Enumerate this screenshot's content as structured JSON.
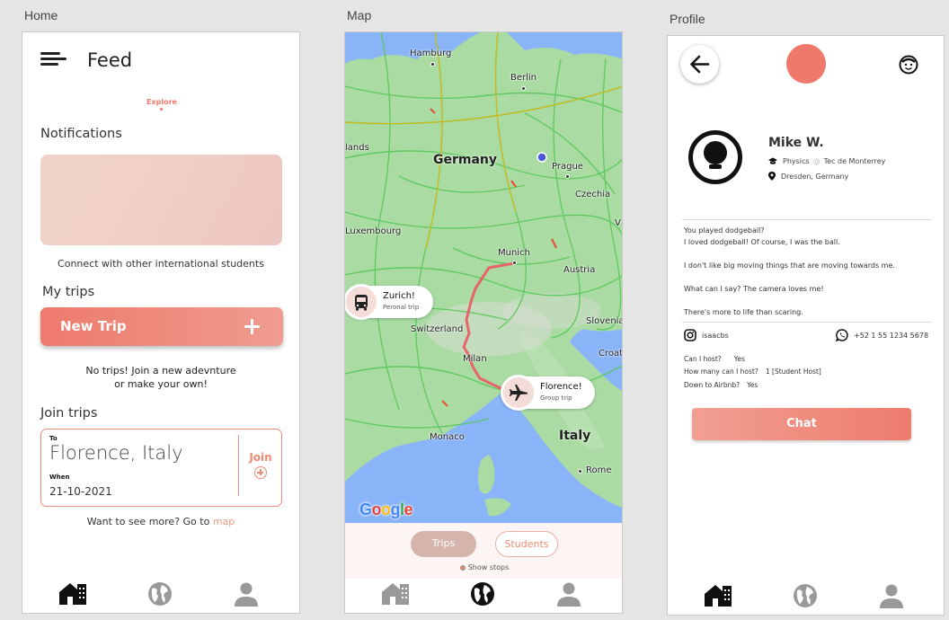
{
  "artboards": {
    "home": "Home",
    "map": "Map",
    "profile": "Profile"
  },
  "home": {
    "title": "Feed",
    "explore_label": "Explore",
    "notifications_heading": "Notifications",
    "notifications_caption": "Connect with other international students",
    "my_trips_heading": "My trips",
    "new_trip_label": "New Trip",
    "no_trips_line1": "No trips! Join a new adevnture",
    "no_trips_line2": "or make your own!",
    "join_trips_heading": "Join trips",
    "join_card": {
      "to_label": "To",
      "destination": "Florence, Italy",
      "when_label": "When",
      "date": "21-10-2021",
      "join_label": "Join"
    },
    "see_more_text": "Want to see more? Go to ",
    "see_more_link": "map"
  },
  "map": {
    "labels": {
      "germany": "Germany",
      "italy": "Italy",
      "hamburg": "Hamburg",
      "berlin": "Berlin",
      "lands": "lands",
      "prague": "Prague",
      "czechia": "Czechia",
      "luxembourg": "Luxembourg",
      "munich": "Munich",
      "austria": "Austria",
      "switzerland": "Switzerland",
      "slovenia": "Slovenia",
      "croat": "Croat",
      "milan": "Milan",
      "monaco": "Monaco",
      "rome": "Rome",
      "v_edge": "V"
    },
    "stops": [
      {
        "title": "Zurich!",
        "subtitle": "Peronal trip",
        "icon": "bus-icon"
      },
      {
        "title": "Florence!",
        "subtitle": "Group trip",
        "icon": "airplane-icon"
      }
    ],
    "google_letters": [
      {
        "ch": "G",
        "color": "#4285F4"
      },
      {
        "ch": "o",
        "color": "#EA4335"
      },
      {
        "ch": "o",
        "color": "#FBBC05"
      },
      {
        "ch": "g",
        "color": "#4285F4"
      },
      {
        "ch": "l",
        "color": "#34A853"
      },
      {
        "ch": "e",
        "color": "#EA4335"
      }
    ],
    "tab_trips": "Trips",
    "tab_students": "Students",
    "show_stops": "Show stops",
    "route_color": "#e8646a"
  },
  "profile": {
    "name": "Mike W.",
    "major": "Physics",
    "at": "@",
    "school": "Tec de Monterrey",
    "location": "Dresden, Germany",
    "bio": [
      "You played dodgeball?",
      "I loved dodgeball! Of course, I was the ball.",
      "I don't like big moving things that are moving towards me.",
      "What can I say? The camera loves me!",
      "There's more to life than scaring."
    ],
    "instagram": "isaacbs",
    "whatsapp": "+52 1 55 1234 5678",
    "qa": [
      {
        "q": "Can I host?",
        "a": "Yes"
      },
      {
        "q": "How many can I host?",
        "a": "1 [Student Host]"
      },
      {
        "q": "Down to Airbnb?",
        "a": "Yes"
      }
    ],
    "chat_label": "Chat"
  },
  "colors": {
    "accent": "#ef7a6c",
    "accent_light": "#efa091",
    "nav_icon": "#999999",
    "nav_icon_active": "#111111"
  }
}
